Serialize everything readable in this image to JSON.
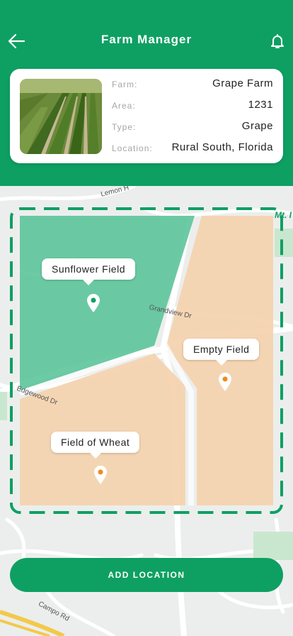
{
  "header": {
    "title": "Farm Manager"
  },
  "farm": {
    "rows": [
      {
        "label": "Farm:",
        "value": "Grape Farm"
      },
      {
        "label": "Area:",
        "value": "1231"
      },
      {
        "label": "Type:",
        "value": "Grape"
      },
      {
        "label": "Location:",
        "value": "Rural South, Florida"
      }
    ]
  },
  "map": {
    "streets": {
      "lemon": "Lemon H",
      "grandview": "Grandview Dr",
      "edgewood": "Edgewood Dr",
      "campo": "Campo Rd",
      "mt": "Mt. I"
    },
    "fields": [
      {
        "name": "Sunflower Field",
        "color": "#5cc49a",
        "pin_color": "#0ea063"
      },
      {
        "name": "Empty Field",
        "color": "#f4d3b0",
        "pin_color": "#f08a1c"
      },
      {
        "name": "Field of Wheat",
        "color": "#f4d3b0",
        "pin_color": "#f08a1c"
      }
    ]
  },
  "colors": {
    "primary": "#0ea063",
    "boundary": "#0ea063"
  },
  "actions": {
    "add_location": "ADD LOCATION"
  }
}
